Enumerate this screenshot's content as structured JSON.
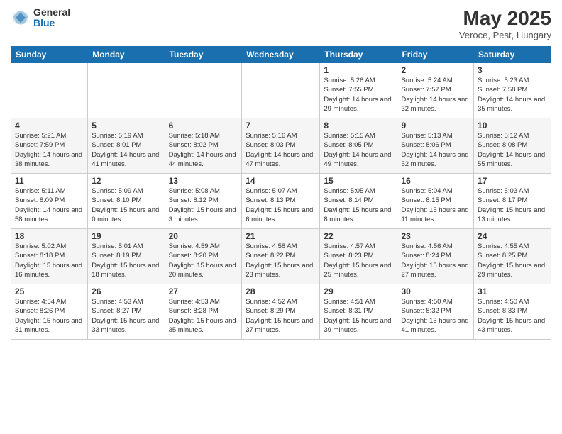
{
  "logo": {
    "general": "General",
    "blue": "Blue"
  },
  "title": "May 2025",
  "location": "Veroce, Pest, Hungary",
  "days_of_week": [
    "Sunday",
    "Monday",
    "Tuesday",
    "Wednesday",
    "Thursday",
    "Friday",
    "Saturday"
  ],
  "weeks": [
    [
      {
        "day": "",
        "info": ""
      },
      {
        "day": "",
        "info": ""
      },
      {
        "day": "",
        "info": ""
      },
      {
        "day": "",
        "info": ""
      },
      {
        "day": "1",
        "info": "Sunrise: 5:26 AM\nSunset: 7:55 PM\nDaylight: 14 hours\nand 29 minutes."
      },
      {
        "day": "2",
        "info": "Sunrise: 5:24 AM\nSunset: 7:57 PM\nDaylight: 14 hours\nand 32 minutes."
      },
      {
        "day": "3",
        "info": "Sunrise: 5:23 AM\nSunset: 7:58 PM\nDaylight: 14 hours\nand 35 minutes."
      }
    ],
    [
      {
        "day": "4",
        "info": "Sunrise: 5:21 AM\nSunset: 7:59 PM\nDaylight: 14 hours\nand 38 minutes."
      },
      {
        "day": "5",
        "info": "Sunrise: 5:19 AM\nSunset: 8:01 PM\nDaylight: 14 hours\nand 41 minutes."
      },
      {
        "day": "6",
        "info": "Sunrise: 5:18 AM\nSunset: 8:02 PM\nDaylight: 14 hours\nand 44 minutes."
      },
      {
        "day": "7",
        "info": "Sunrise: 5:16 AM\nSunset: 8:03 PM\nDaylight: 14 hours\nand 47 minutes."
      },
      {
        "day": "8",
        "info": "Sunrise: 5:15 AM\nSunset: 8:05 PM\nDaylight: 14 hours\nand 49 minutes."
      },
      {
        "day": "9",
        "info": "Sunrise: 5:13 AM\nSunset: 8:06 PM\nDaylight: 14 hours\nand 52 minutes."
      },
      {
        "day": "10",
        "info": "Sunrise: 5:12 AM\nSunset: 8:08 PM\nDaylight: 14 hours\nand 55 minutes."
      }
    ],
    [
      {
        "day": "11",
        "info": "Sunrise: 5:11 AM\nSunset: 8:09 PM\nDaylight: 14 hours\nand 58 minutes."
      },
      {
        "day": "12",
        "info": "Sunrise: 5:09 AM\nSunset: 8:10 PM\nDaylight: 15 hours\nand 0 minutes."
      },
      {
        "day": "13",
        "info": "Sunrise: 5:08 AM\nSunset: 8:12 PM\nDaylight: 15 hours\nand 3 minutes."
      },
      {
        "day": "14",
        "info": "Sunrise: 5:07 AM\nSunset: 8:13 PM\nDaylight: 15 hours\nand 6 minutes."
      },
      {
        "day": "15",
        "info": "Sunrise: 5:05 AM\nSunset: 8:14 PM\nDaylight: 15 hours\nand 8 minutes."
      },
      {
        "day": "16",
        "info": "Sunrise: 5:04 AM\nSunset: 8:15 PM\nDaylight: 15 hours\nand 11 minutes."
      },
      {
        "day": "17",
        "info": "Sunrise: 5:03 AM\nSunset: 8:17 PM\nDaylight: 15 hours\nand 13 minutes."
      }
    ],
    [
      {
        "day": "18",
        "info": "Sunrise: 5:02 AM\nSunset: 8:18 PM\nDaylight: 15 hours\nand 16 minutes."
      },
      {
        "day": "19",
        "info": "Sunrise: 5:01 AM\nSunset: 8:19 PM\nDaylight: 15 hours\nand 18 minutes."
      },
      {
        "day": "20",
        "info": "Sunrise: 4:59 AM\nSunset: 8:20 PM\nDaylight: 15 hours\nand 20 minutes."
      },
      {
        "day": "21",
        "info": "Sunrise: 4:58 AM\nSunset: 8:22 PM\nDaylight: 15 hours\nand 23 minutes."
      },
      {
        "day": "22",
        "info": "Sunrise: 4:57 AM\nSunset: 8:23 PM\nDaylight: 15 hours\nand 25 minutes."
      },
      {
        "day": "23",
        "info": "Sunrise: 4:56 AM\nSunset: 8:24 PM\nDaylight: 15 hours\nand 27 minutes."
      },
      {
        "day": "24",
        "info": "Sunrise: 4:55 AM\nSunset: 8:25 PM\nDaylight: 15 hours\nand 29 minutes."
      }
    ],
    [
      {
        "day": "25",
        "info": "Sunrise: 4:54 AM\nSunset: 8:26 PM\nDaylight: 15 hours\nand 31 minutes."
      },
      {
        "day": "26",
        "info": "Sunrise: 4:53 AM\nSunset: 8:27 PM\nDaylight: 15 hours\nand 33 minutes."
      },
      {
        "day": "27",
        "info": "Sunrise: 4:53 AM\nSunset: 8:28 PM\nDaylight: 15 hours\nand 35 minutes."
      },
      {
        "day": "28",
        "info": "Sunrise: 4:52 AM\nSunset: 8:29 PM\nDaylight: 15 hours\nand 37 minutes."
      },
      {
        "day": "29",
        "info": "Sunrise: 4:51 AM\nSunset: 8:31 PM\nDaylight: 15 hours\nand 39 minutes."
      },
      {
        "day": "30",
        "info": "Sunrise: 4:50 AM\nSunset: 8:32 PM\nDaylight: 15 hours\nand 41 minutes."
      },
      {
        "day": "31",
        "info": "Sunrise: 4:50 AM\nSunset: 8:33 PM\nDaylight: 15 hours\nand 43 minutes."
      }
    ]
  ]
}
